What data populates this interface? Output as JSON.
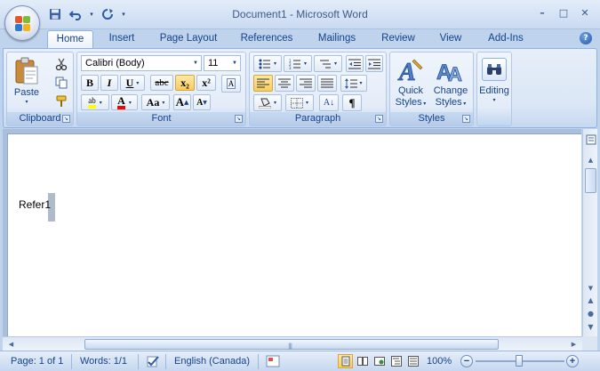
{
  "window": {
    "title": "Document1 - Microsoft Word",
    "minimize": "–",
    "maximize": "□",
    "close": "✕"
  },
  "qat": {
    "dropdown": "▾"
  },
  "tabs": [
    {
      "label": "Home",
      "active": true
    },
    {
      "label": "Insert"
    },
    {
      "label": "Page Layout"
    },
    {
      "label": "References"
    },
    {
      "label": "Mailings"
    },
    {
      "label": "Review"
    },
    {
      "label": "View"
    },
    {
      "label": "Add-Ins"
    }
  ],
  "help": "?",
  "ribbon": {
    "clipboard": {
      "label": "Clipboard",
      "paste": "Paste"
    },
    "font": {
      "label": "Font",
      "font_name": "Calibri (Body)",
      "font_size": "11",
      "bold": "B",
      "italic": "I",
      "underline": "U",
      "strike": "abc",
      "subscript": "x₂",
      "superscript": "x²",
      "highlight": "ab",
      "font_color": "A",
      "change_case": "Aa",
      "grow": "A",
      "shrink": "A",
      "clear": "A"
    },
    "paragraph": {
      "label": "Paragraph",
      "sort": "A↓",
      "show_marks": "¶"
    },
    "styles": {
      "label": "Styles",
      "quick_styles_1": "Quick",
      "quick_styles_2": "Styles",
      "change_styles_1": "Change",
      "change_styles_2": "Styles"
    },
    "editing": {
      "label": "Editing"
    }
  },
  "document": {
    "text": "Refer1"
  },
  "status": {
    "page": "Page: 1 of 1",
    "words": "Words: 1/1",
    "language": "English (Canada)",
    "zoom": "100%",
    "zoom_minus": "−",
    "zoom_plus": "+"
  },
  "colors": {
    "accent": "#15428b",
    "highlight": "#ffff00",
    "font_color": "#ff0000"
  }
}
